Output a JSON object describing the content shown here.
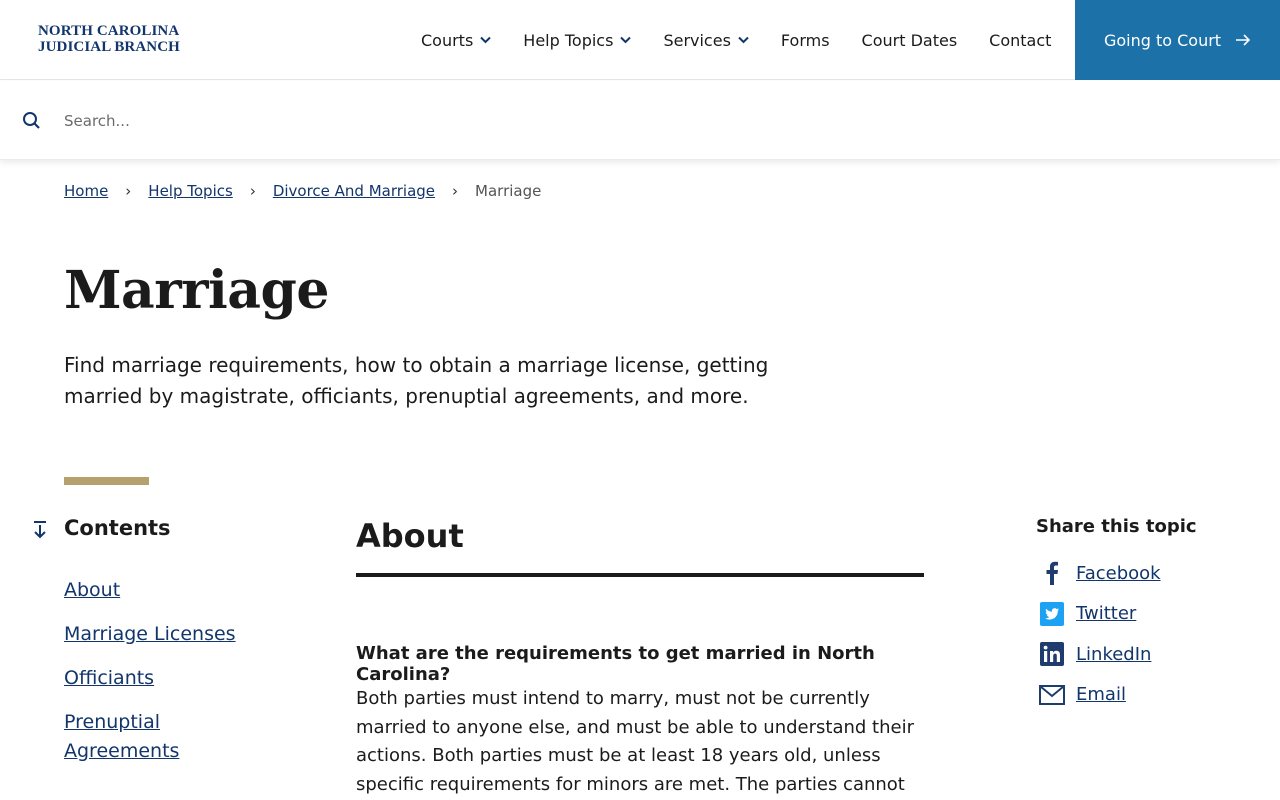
{
  "header": {
    "logo_line1": "NORTH CAROLINA",
    "logo_line2": "JUDICIAL BRANCH",
    "nav": [
      {
        "label": "Courts",
        "dropdown": true
      },
      {
        "label": "Help Topics",
        "dropdown": true
      },
      {
        "label": "Services",
        "dropdown": true
      },
      {
        "label": "Forms",
        "dropdown": false
      },
      {
        "label": "Court Dates",
        "dropdown": false
      },
      {
        "label": "Contact",
        "dropdown": false
      }
    ],
    "cta_label": "Going to Court"
  },
  "search": {
    "placeholder": "Search..."
  },
  "breadcrumb": {
    "items": [
      "Home",
      "Help Topics",
      "Divorce And Marriage"
    ],
    "current": "Marriage"
  },
  "page": {
    "title": "Marriage",
    "lead": "Find marriage requirements, how to obtain a marriage license, getting married by magistrate, officiants, prenuptial agreements, and more."
  },
  "contents": {
    "title": "Contents",
    "links": [
      "About",
      "Marriage Licenses",
      "Officiants",
      "Prenuptial Agreements"
    ]
  },
  "main": {
    "section_title": "About",
    "question": "What are the requirements to get married in North Carolina?",
    "answer": "Both parties must intend to marry, must not be currently married to anyone else, and must be able to understand their actions. Both parties must be at least 18 years old, unless specific requirements for minors are met. The parties cannot be"
  },
  "share": {
    "title": "Share this topic",
    "links": [
      {
        "label": "Facebook",
        "icon": "facebook-icon"
      },
      {
        "label": "Twitter",
        "icon": "twitter-icon"
      },
      {
        "label": "LinkedIn",
        "icon": "linkedin-icon"
      },
      {
        "label": "Email",
        "icon": "email-icon"
      }
    ]
  },
  "colors": {
    "brand_navy": "#12366b",
    "cta_blue": "#1c72a8",
    "accent_gold": "#b5a06e",
    "link": "#12366b"
  }
}
